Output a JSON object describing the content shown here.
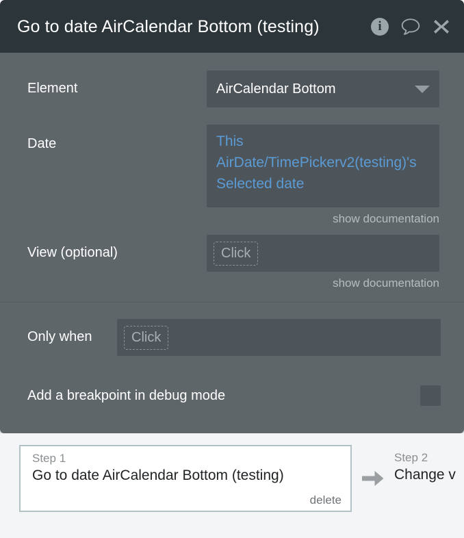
{
  "window": {
    "title": "Go to date AirCalendar Bottom (testing)",
    "icons": {
      "info": "info-icon",
      "comment": "comment-icon",
      "close": "close-icon"
    },
    "info_glyph": "i"
  },
  "form": {
    "element": {
      "label": "Element",
      "value": "AirCalendar Bottom",
      "caret": "chevron-down-icon"
    },
    "date": {
      "label": "Date",
      "value": "This AirDate/TimePickerv2(testing)'s Selected date",
      "doc_link": "show documentation"
    },
    "view": {
      "label": "View (optional)",
      "placeholder": "Click",
      "doc_link": "show documentation"
    },
    "only_when": {
      "label": "Only when",
      "placeholder": "Click"
    },
    "breakpoint": {
      "label": "Add a breakpoint in debug mode",
      "checked": false
    }
  },
  "steps": {
    "arrow": "arrow-right-icon",
    "items": [
      {
        "number": "Step 1",
        "title": "Go to date AirCalendar Bottom (testing)",
        "delete_label": "delete",
        "selected": true
      },
      {
        "number": "Step 2",
        "title": "Change v",
        "selected": false
      }
    ]
  },
  "colors": {
    "titlebar_bg": "#2c3539",
    "panel_bg": "#5f666a",
    "field_bg": "#4e555a",
    "expression_blue": "#5b9bd5",
    "page_bg": "#f4f5f6",
    "step_border": "#b4c1c7"
  }
}
